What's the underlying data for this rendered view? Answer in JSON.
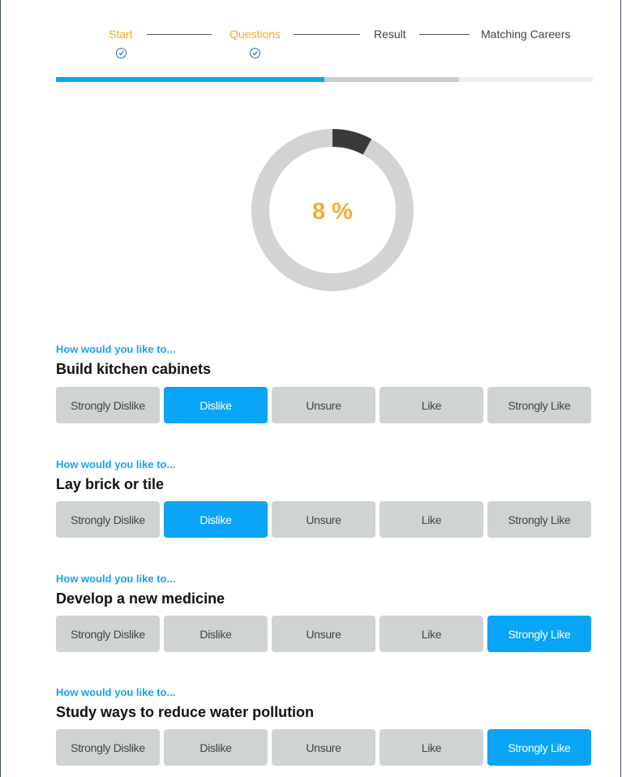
{
  "stepper": {
    "steps": [
      {
        "label": "Start",
        "done": true
      },
      {
        "label": "Questions",
        "done": true
      },
      {
        "label": "Result",
        "done": false
      },
      {
        "label": "Matching Careers",
        "done": false
      }
    ]
  },
  "progress": {
    "percent_label": "8 %",
    "percent": 8,
    "stage_progress_fraction": 0.5,
    "colors": {
      "filled": "#0aa5f7",
      "middle": "#c9cccd",
      "remaining": "#ededf3"
    }
  },
  "questions": [
    {
      "prompt": "How would you like to...",
      "title": "Build kitchen cabinets",
      "options": [
        "Strongly Dislike",
        "Dislike",
        "Unsure",
        "Like",
        "Strongly Like"
      ],
      "selected": "Dislike"
    },
    {
      "prompt": "How would you like to...",
      "title": "Lay brick or tile",
      "options": [
        "Strongly Dislike",
        "Dislike",
        "Unsure",
        "Like",
        "Strongly Like"
      ],
      "selected": "Dislike"
    },
    {
      "prompt": "How would you like to...",
      "title": "Develop a new medicine",
      "options": [
        "Strongly Dislike",
        "Dislike",
        "Unsure",
        "Like",
        "Strongly Like"
      ],
      "selected": "Strongly Like"
    },
    {
      "prompt": "How would you like to...",
      "title": "Study ways to reduce water pollution",
      "options": [
        "Strongly Dislike",
        "Dislike",
        "Unsure",
        "Like",
        "Strongly Like"
      ],
      "selected": "Strongly Like"
    }
  ],
  "colors": {
    "accent": "#0aa5f7",
    "step_done": "#f0a830",
    "percent_text": "#f4ac34",
    "option_bg": "#cfd3d4"
  }
}
